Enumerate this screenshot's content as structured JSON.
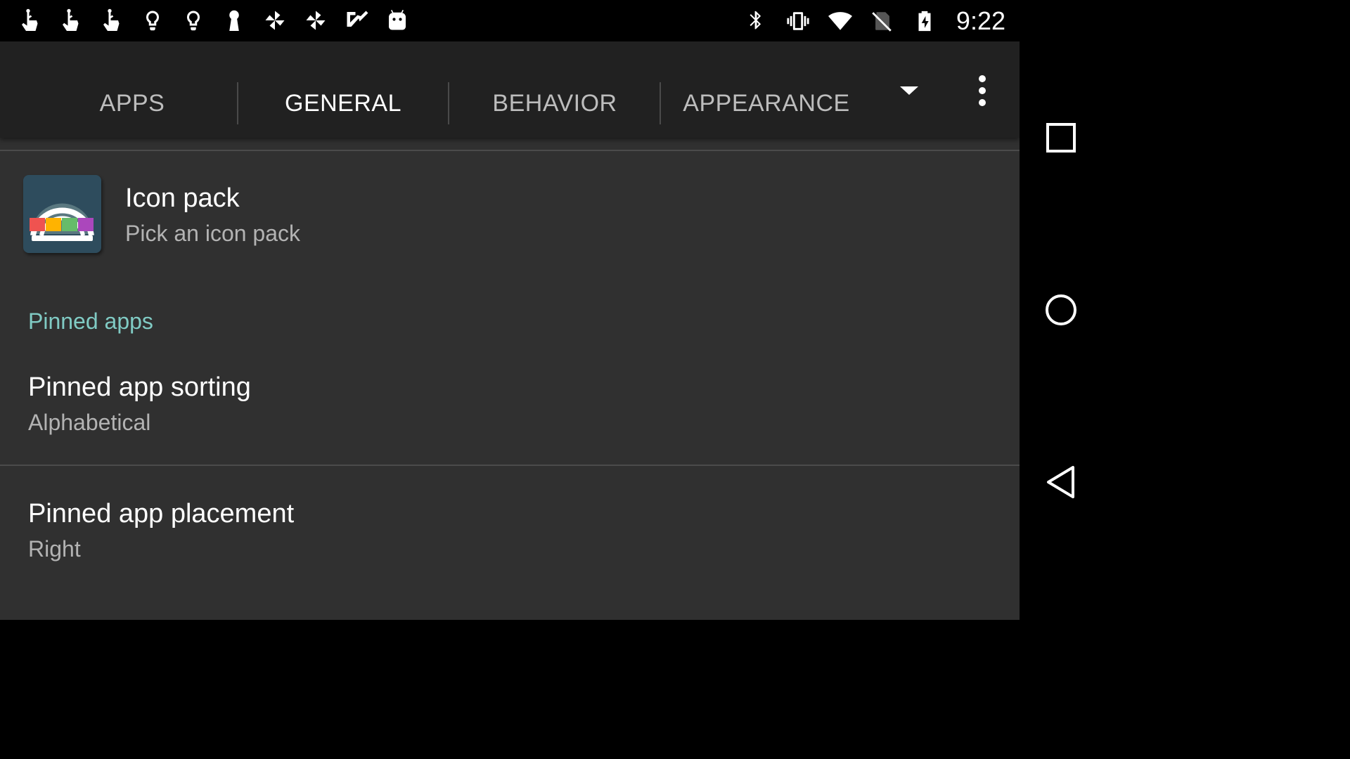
{
  "status_bar": {
    "left_icons": [
      "touch-gesture-icon",
      "touch-gesture-icon",
      "touch-gesture-icon",
      "lightbulb-icon",
      "lightbulb-icon",
      "keyhole-icon",
      "pinwheel-icon",
      "pinwheel-icon",
      "checkmark-icon",
      "android-robot-icon"
    ],
    "right_icons": [
      "bluetooth-icon",
      "vibrate-icon",
      "wifi-icon",
      "no-sim-icon",
      "battery-charging-icon"
    ],
    "time": "9:22"
  },
  "tabs": [
    {
      "label": "APPS",
      "active": false
    },
    {
      "label": "GENERAL",
      "active": true
    },
    {
      "label": "BEHAVIOR",
      "active": false
    },
    {
      "label": "APPEARANCE",
      "active": false
    }
  ],
  "settings": {
    "icon_pack": {
      "title": "Icon pack",
      "summary": "Pick an icon pack"
    },
    "section_header": "Pinned apps",
    "pinned_sorting": {
      "title": "Pinned app sorting",
      "summary": "Alphabetical"
    },
    "pinned_placement": {
      "title": "Pinned app placement",
      "summary": "Right"
    }
  },
  "colors": {
    "accent": "#80cbc4",
    "background": "#303030",
    "tabbar": "#212121",
    "icon_bg": "#2e4c5d",
    "icon_colors": [
      "#ef5350",
      "#ffb300",
      "#66bb6a",
      "#ab47bc"
    ]
  },
  "navigation": [
    "recents-icon",
    "home-icon",
    "back-icon"
  ]
}
